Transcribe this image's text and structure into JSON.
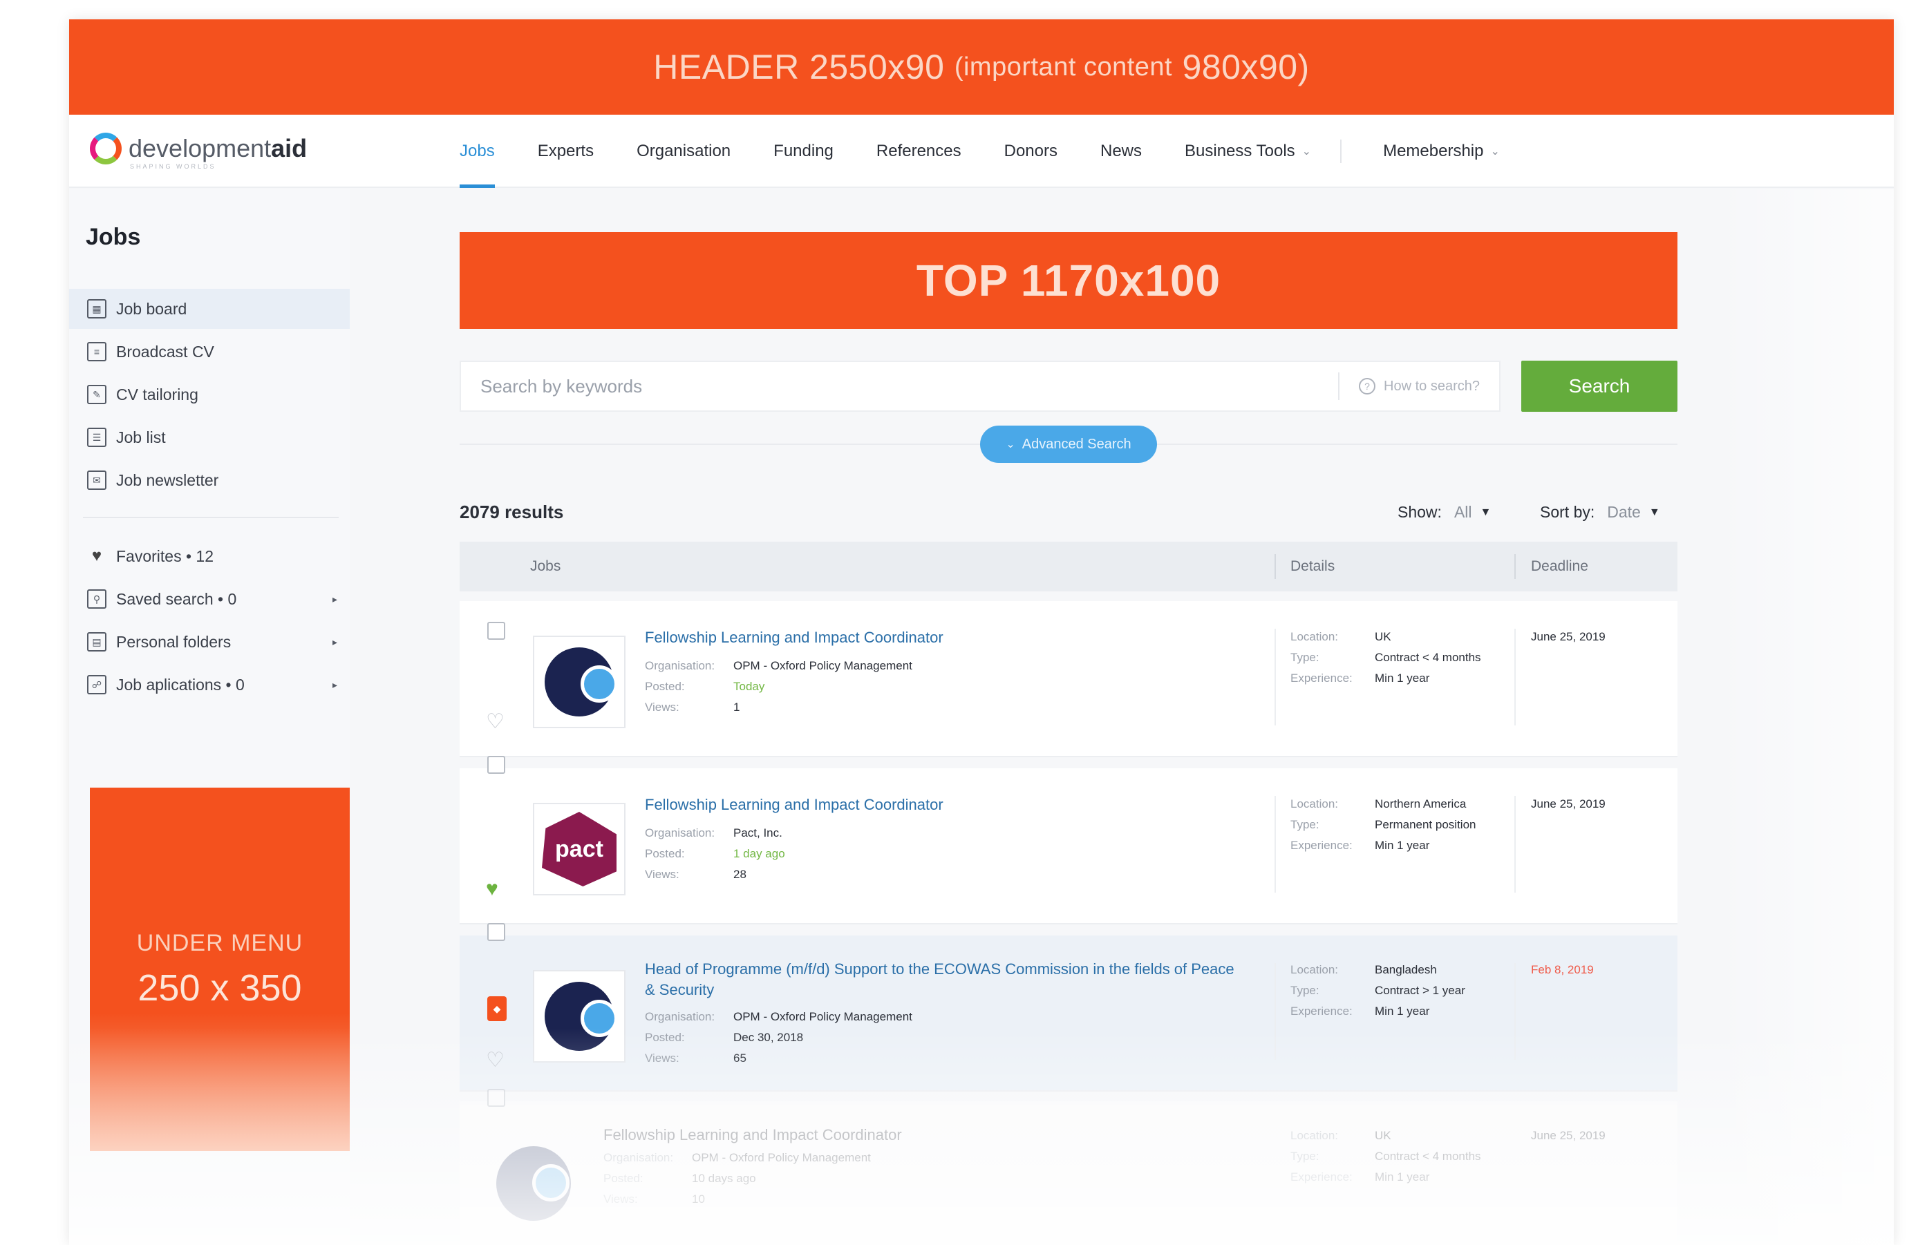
{
  "ads": {
    "header_main": "HEADER 2550x90",
    "header_small": "(important content",
    "header_tail": "980x90)",
    "top": "TOP 1170x100",
    "under_menu_line1": "UNDER MENU",
    "under_menu_line2": "250 x 350"
  },
  "brand": {
    "logo_text_light": "development",
    "logo_text_bold": "aid",
    "tagline": "SHAPING WORLDS"
  },
  "nav": {
    "items": [
      "Jobs",
      "Experts",
      "Organisation",
      "Funding",
      "References",
      "Donors",
      "News",
      "Business Tools"
    ],
    "membership": "Memebership",
    "active": "Jobs"
  },
  "sidebar": {
    "title": "Jobs",
    "items": [
      {
        "label": "Job board",
        "icon": "grid-icon"
      },
      {
        "label": "Broadcast CV",
        "icon": "document-icon"
      },
      {
        "label": "CV tailoring",
        "icon": "edit-icon"
      },
      {
        "label": "Job list",
        "icon": "list-icon"
      },
      {
        "label": "Job newsletter",
        "icon": "newsletter-icon"
      }
    ],
    "secondary": [
      {
        "label": "Favorites • 12",
        "icon": "heart-icon"
      },
      {
        "label": "Saved search • 0",
        "icon": "search-folder-icon"
      },
      {
        "label": "Personal folders",
        "icon": "folder-icon"
      },
      {
        "label": "Job aplications • 0",
        "icon": "application-icon"
      }
    ]
  },
  "search": {
    "placeholder": "Search by keywords",
    "howto": "How to search?",
    "button": "Search",
    "advanced": "Advanced Search"
  },
  "results": {
    "count": "2079 results",
    "show_label": "Show:",
    "show_value": "All",
    "sort_label": "Sort by:",
    "sort_value": "Date"
  },
  "table": {
    "headers": [
      "Jobs",
      "Details",
      "Deadline"
    ]
  },
  "labels": {
    "organisation": "Organisation:",
    "posted": "Posted:",
    "views": "Views:",
    "location": "Location:",
    "type": "Type:",
    "experience": "Experience:"
  },
  "jobs": [
    {
      "title": "Fellowship Learning and Impact Coordinator",
      "organisation": "OPM - Oxford Policy Management",
      "posted": "Today",
      "views": "1",
      "location": "UK",
      "type": "Contract < 4 months",
      "experience": "Min 1 year",
      "deadline": "June 25, 2019"
    },
    {
      "title": "Fellowship Learning and Impact Coordinator",
      "organisation": "Pact, Inc.",
      "posted": "1 day ago",
      "views": "28",
      "location": "Northern America",
      "type": "Permanent position",
      "experience": "Min 1 year",
      "deadline": "June 25, 2019",
      "logo_text": "pact"
    },
    {
      "title": "Head of Programme (m/f/d) Support to the ECOWAS Commission in the fields of Peace & Security",
      "organisation": "OPM - Oxford Policy Management",
      "posted": "Dec 30, 2018",
      "views": "65",
      "location": "Bangladesh",
      "type": "Contract > 1 year",
      "experience": "Min 1 year",
      "deadline": "Feb 8, 2019"
    },
    {
      "title": "Fellowship Learning and Impact Coordinator",
      "organisation": "OPM - Oxford Policy Management",
      "posted": "10 days ago",
      "views": "10",
      "location": "UK",
      "type": "Contract < 4 months",
      "experience": "Min 1 year",
      "deadline": "June 25, 2019"
    }
  ],
  "colors": {
    "accent_orange": "#f4511e",
    "search_green": "#64ac3c",
    "link_blue": "#2b6fa8",
    "nav_active_blue": "#2b8fd6"
  }
}
